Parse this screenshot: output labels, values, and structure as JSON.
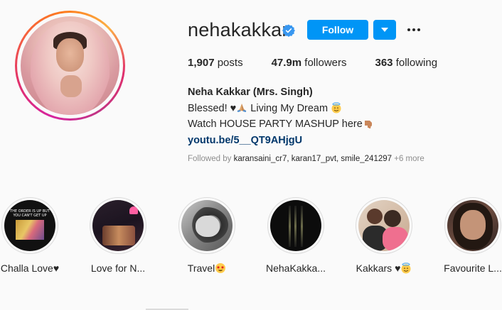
{
  "profile": {
    "username": "nehakakkar",
    "verified": true,
    "follow_label": "Follow",
    "dropdown_icon": "chevron-down-icon",
    "more_icon": "more-dots-icon",
    "stats": {
      "posts_value": "1,907",
      "posts_label": "posts",
      "followers_value": "47.9m",
      "followers_label": "followers",
      "following_value": "363",
      "following_label": "following"
    },
    "bio": {
      "name": "Neha Kakkar (Mrs. Singh)",
      "line1": "Blessed! ♥",
      "line1_rest": " Living My Dream ",
      "line2": "Watch HOUSE PARTY MASHUP here",
      "link": "youtu.be/5__QT9AHjgU"
    },
    "followed_by": {
      "prefix": "Followed by ",
      "users": "karansaini_cr7, karan17_pvt, smile_241297",
      "more": " +6 more"
    }
  },
  "highlights": [
    {
      "label": "Challa Love♥",
      "thumb_text": "THE ORDER IS UP BUT YOU CAN'T GET UP"
    },
    {
      "label": "Love for N..."
    },
    {
      "label": "Travel"
    },
    {
      "label": "NehaKakka..."
    },
    {
      "label": "Kakkars ♥"
    },
    {
      "label": "Favourite L..."
    }
  ],
  "colors": {
    "accent": "#0095f6",
    "link": "#00376b",
    "muted": "#8e8e8e",
    "background": "#fafafa"
  }
}
